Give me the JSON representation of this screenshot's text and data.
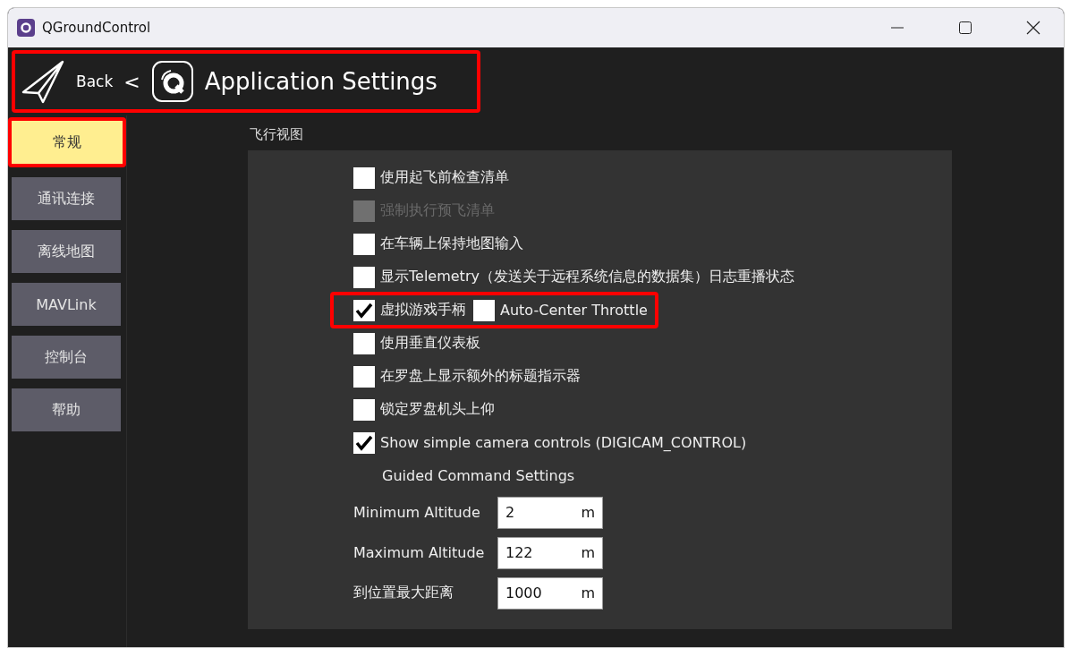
{
  "window": {
    "title": "QGroundControl"
  },
  "header": {
    "back": "Back",
    "separator": "<",
    "title": "Application Settings",
    "highlighted": true
  },
  "sidebar": {
    "items": [
      {
        "label": "常规",
        "selected": true,
        "highlighted": true
      },
      {
        "label": "通讯连接",
        "selected": false,
        "highlighted": false
      },
      {
        "label": "离线地图",
        "selected": false,
        "highlighted": false
      },
      {
        "label": "MAVLink",
        "selected": false,
        "highlighted": false
      },
      {
        "label": "控制台",
        "selected": false,
        "highlighted": false
      },
      {
        "label": "帮助",
        "selected": false,
        "highlighted": false
      }
    ]
  },
  "section": {
    "title": "飞行视图",
    "rows": [
      {
        "kind": "checkbox",
        "highlighted": false,
        "options": [
          {
            "label": "使用起飞前检查清单",
            "checked": false,
            "disabled": false
          }
        ]
      },
      {
        "kind": "checkbox",
        "highlighted": false,
        "options": [
          {
            "label": "强制执行预飞清单",
            "checked": false,
            "disabled": true
          }
        ]
      },
      {
        "kind": "checkbox",
        "highlighted": false,
        "options": [
          {
            "label": "在车辆上保持地图输入",
            "checked": false,
            "disabled": false
          }
        ]
      },
      {
        "kind": "checkbox",
        "highlighted": false,
        "options": [
          {
            "label": "显示Telemetry（发送关于远程系统信息的数据集）日志重播状态",
            "checked": false,
            "disabled": false
          }
        ]
      },
      {
        "kind": "checkbox",
        "highlighted": true,
        "options": [
          {
            "label": "虚拟游戏手柄",
            "checked": true,
            "disabled": false
          },
          {
            "label": "Auto-Center Throttle",
            "checked": false,
            "disabled": false
          }
        ]
      },
      {
        "kind": "checkbox",
        "highlighted": false,
        "options": [
          {
            "label": "使用垂直仪表板",
            "checked": false,
            "disabled": false
          }
        ]
      },
      {
        "kind": "checkbox",
        "highlighted": false,
        "options": [
          {
            "label": "在罗盘上显示额外的标题指示器",
            "checked": false,
            "disabled": false
          }
        ]
      },
      {
        "kind": "checkbox",
        "highlighted": false,
        "options": [
          {
            "label": "锁定罗盘机头上仰",
            "checked": false,
            "disabled": false
          }
        ]
      },
      {
        "kind": "checkbox",
        "highlighted": false,
        "options": [
          {
            "label": "Show simple camera controls (DIGICAM_CONTROL)",
            "checked": true,
            "disabled": false
          }
        ]
      },
      {
        "kind": "heading",
        "label": "Guided Command Settings"
      },
      {
        "kind": "field",
        "label": "Minimum Altitude",
        "value": "2",
        "unit": "m"
      },
      {
        "kind": "field",
        "label": "Maximum Altitude",
        "value": "122",
        "unit": "m"
      },
      {
        "kind": "field",
        "label": "到位置最大距离",
        "value": "1000",
        "unit": "m"
      }
    ]
  }
}
